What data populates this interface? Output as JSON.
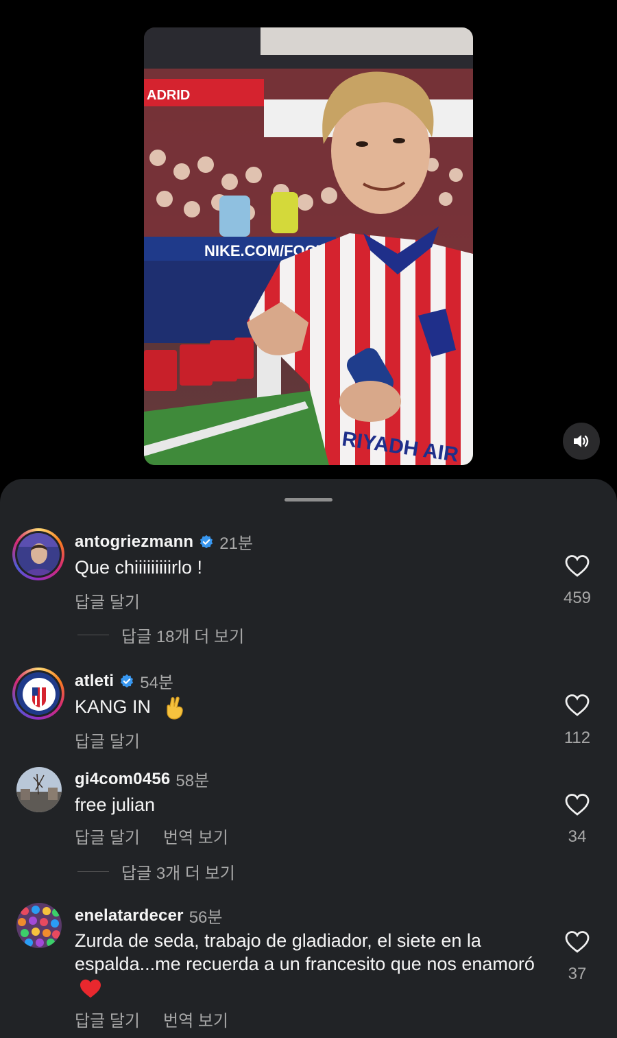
{
  "comments": [
    {
      "username": "antogriezmann",
      "verified": true,
      "time": "21분",
      "text": "Que chiiiiiiiiirlo !",
      "reply": "답글 달기",
      "likes": "459",
      "more_replies": "답글 18개 더 보기"
    },
    {
      "username": "atleti",
      "verified": true,
      "time": "54분",
      "text": "KANG IN",
      "emoji": "crossed-fingers-emoji",
      "reply": "답글 달기",
      "likes": "112"
    },
    {
      "username": "gi4com0456",
      "verified": false,
      "time": "58분",
      "text": "free julian",
      "reply": "답글 달기",
      "translate": "번역 보기",
      "likes": "34",
      "more_replies": "답글 3개 더 보기"
    },
    {
      "username": "enelatardecer",
      "verified": false,
      "time": "56분",
      "text": "Zurda de seda, trabajo de gladiador, el siete en la espalda...me recuerda a un francesito que nos enamoró",
      "emoji": "red-heart-emoji",
      "reply": "답글 달기",
      "translate": "번역 보기",
      "likes": "37"
    }
  ],
  "video": {
    "jersey_sponsor": "RIYADH AIR",
    "board_text": "NIKE.COM/FOOTBALL",
    "banner_text": "ADRID"
  },
  "colors": {
    "sheet_bg": "#212326",
    "verified_blue": "#3897f0",
    "secondary_text": "#a8a8a8"
  }
}
